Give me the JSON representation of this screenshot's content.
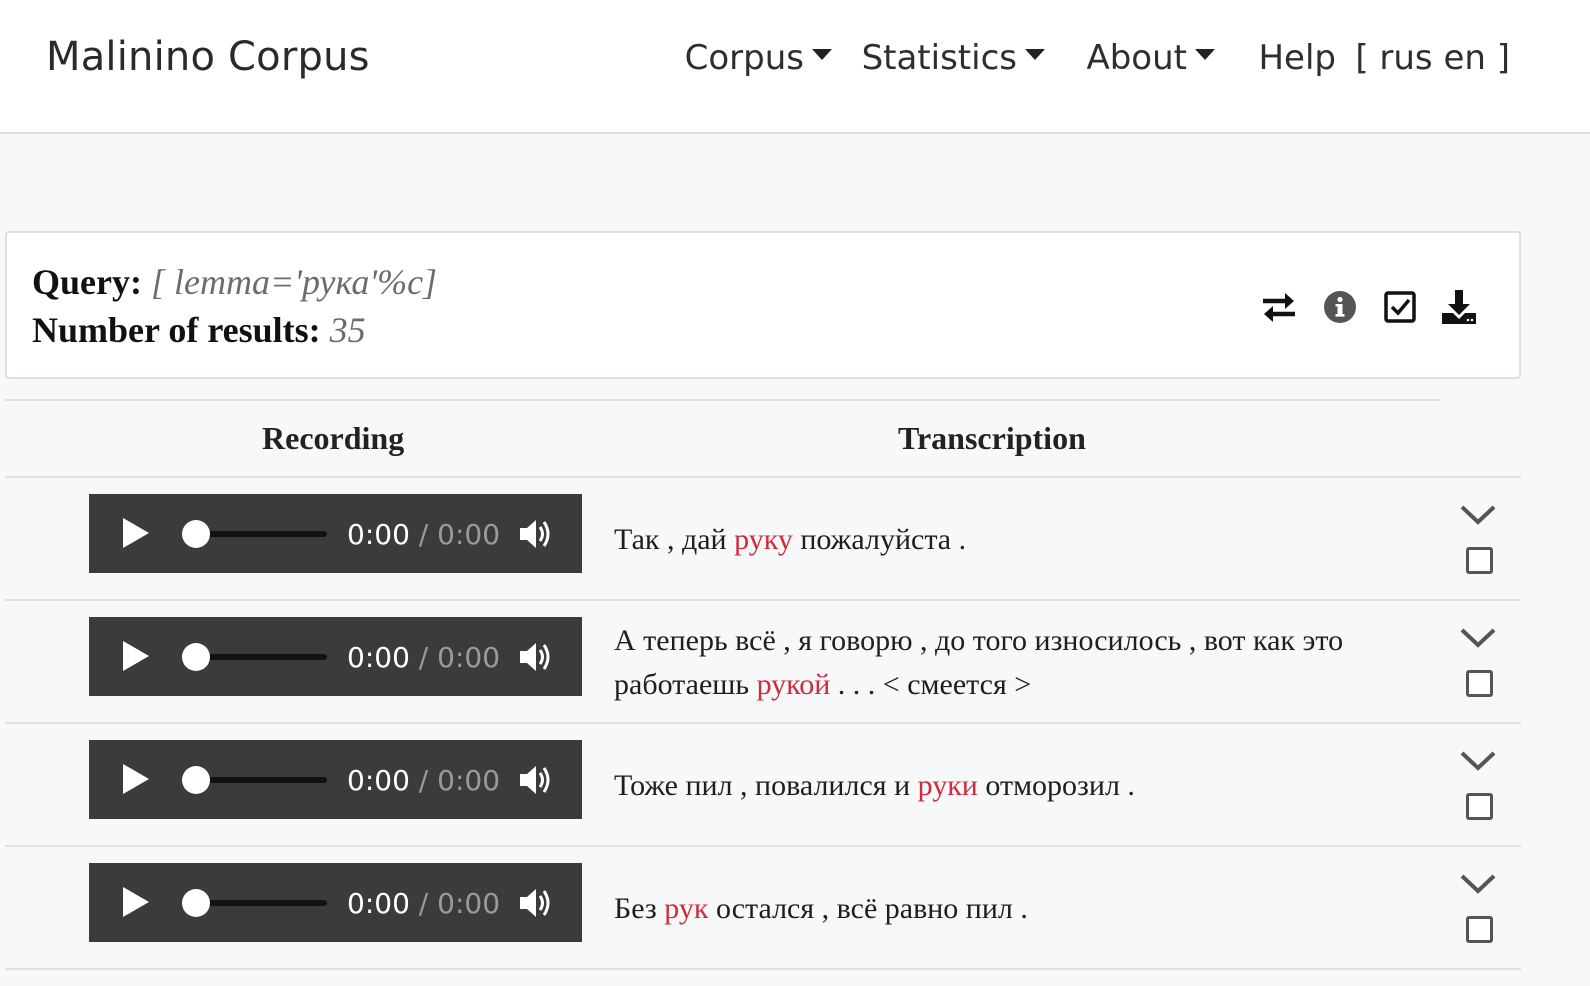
{
  "navbar": {
    "brand": "Malinino Corpus",
    "items": [
      {
        "label": "Corpus"
      },
      {
        "label": "Statistics"
      },
      {
        "label": "About"
      },
      {
        "label": "Help"
      },
      {
        "label": "[ rus en ]"
      }
    ]
  },
  "query": {
    "query_label": "Query:",
    "query_value": "[ lemma='рука'%c]",
    "results_label": "Number of results:",
    "results_value": "35",
    "tools": [
      "swap-icon",
      "info-icon",
      "check-square-icon",
      "download-icon"
    ]
  },
  "table": {
    "headers": {
      "recording": "Recording",
      "transcription": "Transcription"
    },
    "rows": [
      {
        "time_current": "0:00",
        "time_sep": "/",
        "time_duration": "0:00",
        "before": "Так , дай ",
        "hit": "руку",
        "after": " пожалуйста ."
      },
      {
        "time_current": "0:00",
        "time_sep": "/",
        "time_duration": "0:00",
        "before": "А теперь всё , я говорю , до того износилось , вот как это работаешь ",
        "hit": "рукой",
        "after": " . . . < смеется >"
      },
      {
        "time_current": "0:00",
        "time_sep": "/",
        "time_duration": "0:00",
        "before": "Тоже пил , повалился и ",
        "hit": "руки",
        "after": " отморозил ."
      },
      {
        "time_current": "0:00",
        "time_sep": "/",
        "time_duration": "0:00",
        "before": "Без ",
        "hit": "рук",
        "after": " остался , всё равно пил ."
      }
    ]
  },
  "colors": {
    "highlight": "#d12a3a",
    "player_bg": "#3b3b3b",
    "page_bg": "#f7f8fa"
  }
}
